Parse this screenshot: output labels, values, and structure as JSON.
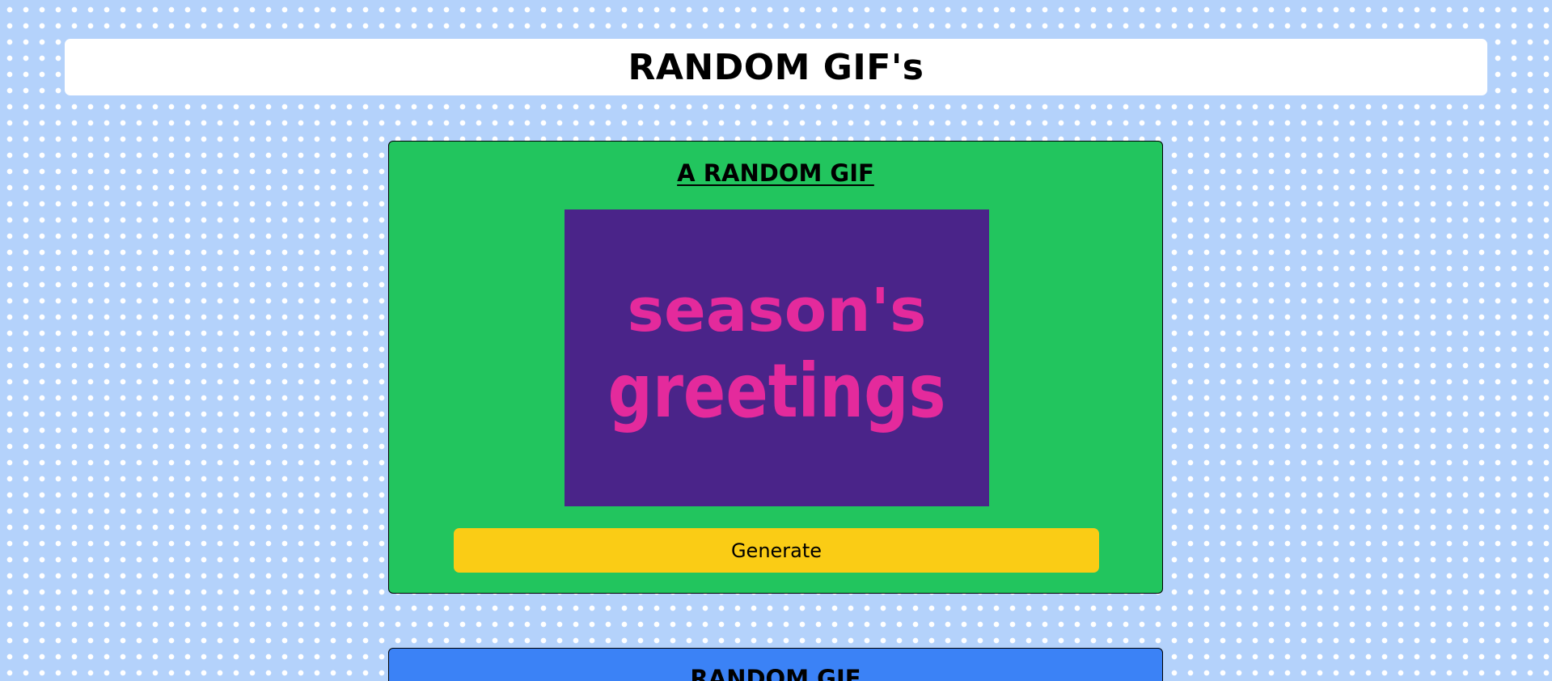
{
  "header": {
    "title": "RANDOM GIF's"
  },
  "random_card": {
    "title": "A RANDOM GIF",
    "gif_text": {
      "line1": "season's",
      "line2": "greetings"
    },
    "generate_label": "Generate"
  },
  "tag_card": {
    "title": "RANDOM GIF"
  },
  "colors": {
    "page_bg": "#b4d2fb",
    "dots": "#ffffff",
    "header_bg": "#ffffff",
    "random_card_bg": "#22c55e",
    "tag_card_bg": "#3b82f6",
    "gif_bg": "#4a2489",
    "gif_text": "#e42a9c",
    "button_bg": "#facc15"
  }
}
